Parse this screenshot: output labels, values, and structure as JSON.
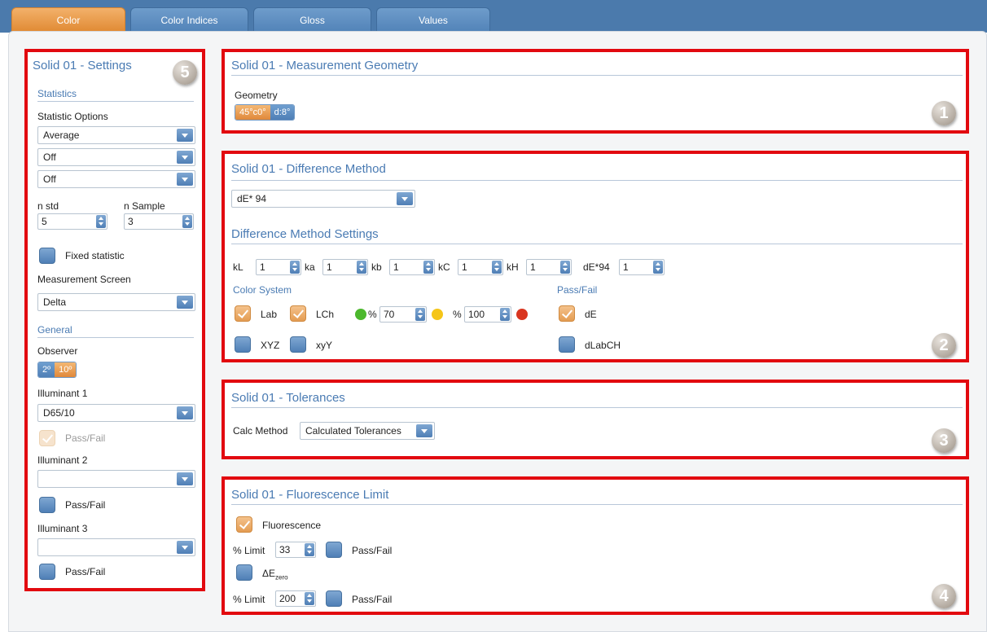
{
  "tabs": [
    {
      "label": "Color"
    },
    {
      "label": "Color Indices"
    },
    {
      "label": "Gloss"
    },
    {
      "label": "Values"
    }
  ],
  "settings": {
    "title": "Solid 01 - Settings",
    "badge": "5",
    "statistics_header": "Statistics",
    "statistic_options_label": "Statistic Options",
    "statistic_option_1": "Average",
    "statistic_option_2": "Off",
    "statistic_option_3": "Off",
    "n_std_label": "n std",
    "n_std_value": "5",
    "n_sample_label": "n Sample",
    "n_sample_value": "3",
    "fixed_statistic_label": "Fixed statistic",
    "measurement_screen_label": "Measurement Screen",
    "measurement_screen_value": "Delta",
    "general_header": "General",
    "observer_label": "Observer",
    "observer_options": [
      "2º",
      "10º"
    ],
    "illuminant1_label": "Illuminant 1",
    "illuminant1_value": "D65/10",
    "illuminant1_passfail": "Pass/Fail",
    "illuminant2_label": "Illuminant 2",
    "illuminant2_value": "",
    "illuminant2_passfail": "Pass/Fail",
    "illuminant3_label": "Illuminant 3",
    "illuminant3_value": "",
    "illuminant3_passfail": "Pass/Fail"
  },
  "geometry": {
    "title": "Solid 01 - Measurement Geometry",
    "badge": "1",
    "label": "Geometry",
    "options": [
      "45°c0°",
      "d:8°"
    ]
  },
  "difference": {
    "title": "Solid 01 - Difference Method",
    "badge": "2",
    "method_value": "dE* 94",
    "settings_title": "Difference Method Settings",
    "params": [
      {
        "label": "kL",
        "value": "1"
      },
      {
        "label": "ka",
        "value": "1"
      },
      {
        "label": "kb",
        "value": "1"
      },
      {
        "label": "kC",
        "value": "1"
      },
      {
        "label": "kH",
        "value": "1"
      },
      {
        "label": "dE*94",
        "value": "1"
      }
    ],
    "color_system_label": "Color System",
    "lab_label": "Lab",
    "lch_label": "LCh",
    "xyz_label": "XYZ",
    "xyy_label": "xyY",
    "pct_symbol": "%",
    "pct_green_value": "70",
    "pct_yellow_value": "100",
    "passfail_label": "Pass/Fail",
    "de_label": "dE",
    "dlabch_label": "dLabCH",
    "colors": {
      "green": "#4cb82d",
      "yellow": "#f5c518",
      "red": "#d9351f"
    }
  },
  "tolerances": {
    "title": "Solid 01 - Tolerances",
    "badge": "3",
    "calc_method_label": "Calc Method",
    "calc_method_value": "Calculated Tolerances"
  },
  "fluorescence": {
    "title": "Solid 01 - Fluorescence Limit",
    "badge": "4",
    "fluorescence_label": "Fluorescence",
    "limit_label": "% Limit",
    "limit1_value": "33",
    "passfail_label": "Pass/Fail",
    "delta_e": "ΔE",
    "delta_e_sub": "zero",
    "limit2_value": "200"
  }
}
